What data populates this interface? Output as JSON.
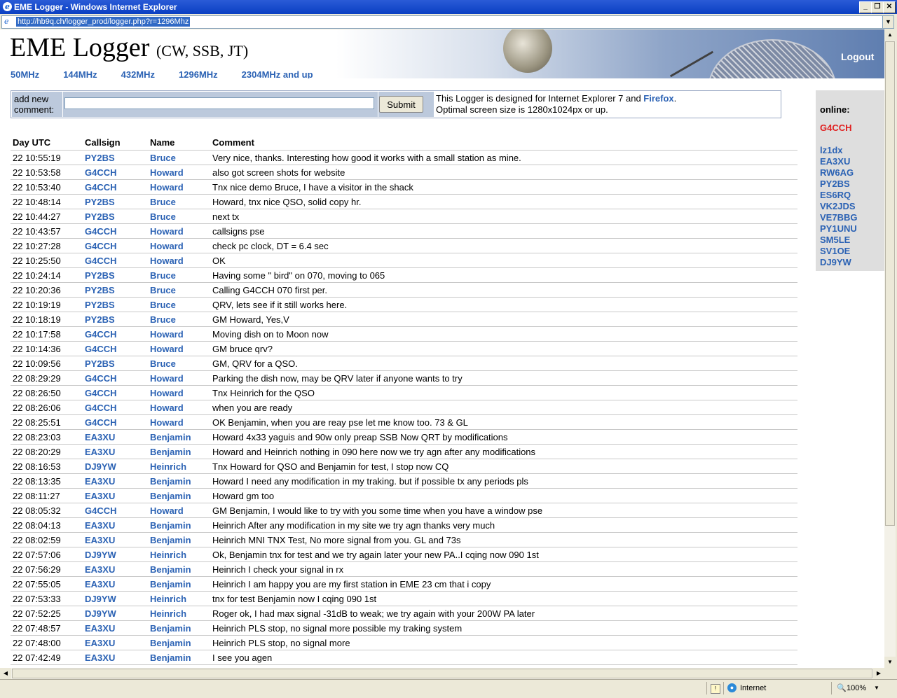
{
  "window": {
    "title": "EME Logger - Windows Internet Explorer",
    "url": "http://hb9q.ch/logger_prod/logger.php?r=1296Mhz"
  },
  "header": {
    "brand": "EME Logger",
    "subtitle": "(CW, SSB, JT)",
    "logout": "Logout",
    "bands": [
      "50MHz",
      "144MHz",
      "432MHz",
      "1296MHz",
      "2304MHz and up"
    ]
  },
  "comment_form": {
    "label": "add new comment:",
    "value": "",
    "submit": "Submit",
    "info_line1_prefix": "This Logger is designed for Internet Explorer 7 and ",
    "info_link": "Firefox",
    "info_line1_suffix": ".",
    "info_line2": "Optimal screen size is 1280x1024px or up."
  },
  "online": {
    "title": "online:",
    "me": "G4CCH",
    "users": [
      "lz1dx",
      "EA3XU",
      "RW6AG",
      "PY2BS",
      "ES6RQ",
      "VK2JDS",
      "VE7BBG",
      "PY1UNU",
      "SM5LE",
      "SV1OE",
      "DJ9YW"
    ]
  },
  "log": {
    "columns": [
      "Day UTC",
      "Callsign",
      "Name",
      "Comment"
    ],
    "rows": [
      [
        "22 10:55:19",
        "PY2BS",
        "Bruce",
        "Very nice, thanks. Interesting how good it works with a small station as mine."
      ],
      [
        "22 10:53:58",
        "G4CCH",
        "Howard",
        "also got screen shots for website"
      ],
      [
        "22 10:53:40",
        "G4CCH",
        "Howard",
        "Tnx nice demo Bruce, I have a visitor in the shack"
      ],
      [
        "22 10:48:14",
        "PY2BS",
        "Bruce",
        "Howard, tnx nice QSO, solid copy hr."
      ],
      [
        "22 10:44:27",
        "PY2BS",
        "Bruce",
        "next tx"
      ],
      [
        "22 10:43:57",
        "G4CCH",
        "Howard",
        "callsigns pse"
      ],
      [
        "22 10:27:28",
        "G4CCH",
        "Howard",
        "check pc clock, DT = 6.4 sec"
      ],
      [
        "22 10:25:50",
        "G4CCH",
        "Howard",
        "OK"
      ],
      [
        "22 10:24:14",
        "PY2BS",
        "Bruce",
        "Having some \" bird\" on 070, moving to 065"
      ],
      [
        "22 10:20:36",
        "PY2BS",
        "Bruce",
        "Calling G4CCH 070 first per."
      ],
      [
        "22 10:19:19",
        "PY2BS",
        "Bruce",
        "QRV, lets see if it still works here."
      ],
      [
        "22 10:18:19",
        "PY2BS",
        "Bruce",
        "GM Howard, Yes,V"
      ],
      [
        "22 10:17:58",
        "G4CCH",
        "Howard",
        "Moving dish on to Moon now"
      ],
      [
        "22 10:14:36",
        "G4CCH",
        "Howard",
        "GM bruce qrv?"
      ],
      [
        "22 10:09:56",
        "PY2BS",
        "Bruce",
        "GM, QRV for a QSO."
      ],
      [
        "22 08:29:29",
        "G4CCH",
        "Howard",
        "Parking the dish now, may be QRV later if anyone wants to try"
      ],
      [
        "22 08:26:50",
        "G4CCH",
        "Howard",
        "Tnx Heinrich for the QSO"
      ],
      [
        "22 08:26:06",
        "G4CCH",
        "Howard",
        "when you are ready"
      ],
      [
        "22 08:25:51",
        "G4CCH",
        "Howard",
        "OK Benjamin, when you are reay pse let me know too. 73 & GL"
      ],
      [
        "22 08:23:03",
        "EA3XU",
        "Benjamin",
        "Howard 4x33 yaguis and 90w only preap SSB Now QRT by modifications"
      ],
      [
        "22 08:20:29",
        "EA3XU",
        "Benjamin",
        "Howard and Heinrich nothing in 090 here now we try agn after any modifications"
      ],
      [
        "22 08:16:53",
        "DJ9YW",
        "Heinrich",
        "Tnx Howard for QSO and Benjamin for test, I stop now CQ"
      ],
      [
        "22 08:13:35",
        "EA3XU",
        "Benjamin",
        "Howard I need any modification in my traking. but if possible tx any periods pls"
      ],
      [
        "22 08:11:27",
        "EA3XU",
        "Benjamin",
        "Howard gm too"
      ],
      [
        "22 08:05:32",
        "G4CCH",
        "Howard",
        "GM Benjamin, I would like to try with you some time when you have a window pse"
      ],
      [
        "22 08:04:13",
        "EA3XU",
        "Benjamin",
        "Heinrich After any modification in my site we try agn thanks very much"
      ],
      [
        "22 08:02:59",
        "EA3XU",
        "Benjamin",
        "Heinrich MNI TNX Test, No more signal from you. GL and 73s"
      ],
      [
        "22 07:57:06",
        "DJ9YW",
        "Heinrich",
        "Ok, Benjamin tnx for test and we try again later your new PA..I cqing now 090 1st"
      ],
      [
        "22 07:56:29",
        "EA3XU",
        "Benjamin",
        "Heinrich I check your signal in rx"
      ],
      [
        "22 07:55:05",
        "EA3XU",
        "Benjamin",
        "Heinrich I am happy you are my first station in EME 23 cm that i copy"
      ],
      [
        "22 07:53:33",
        "DJ9YW",
        "Heinrich",
        "tnx for test Benjamin now I cqing 090 1st"
      ],
      [
        "22 07:52:25",
        "DJ9YW",
        "Heinrich",
        "Roger ok, I had max signal -31dB to weak; we try again with your 200W PA later"
      ],
      [
        "22 07:48:57",
        "EA3XU",
        "Benjamin",
        "Heinrich PLS stop, no signal more possible my traking system"
      ],
      [
        "22 07:48:00",
        "EA3XU",
        "Benjamin",
        "Heinrich PLS stop, no signal more"
      ],
      [
        "22 07:42:49",
        "EA3XU",
        "Benjamin",
        "I see you agen"
      ]
    ]
  },
  "status": {
    "zone": "Internet",
    "zoom": "100%"
  }
}
